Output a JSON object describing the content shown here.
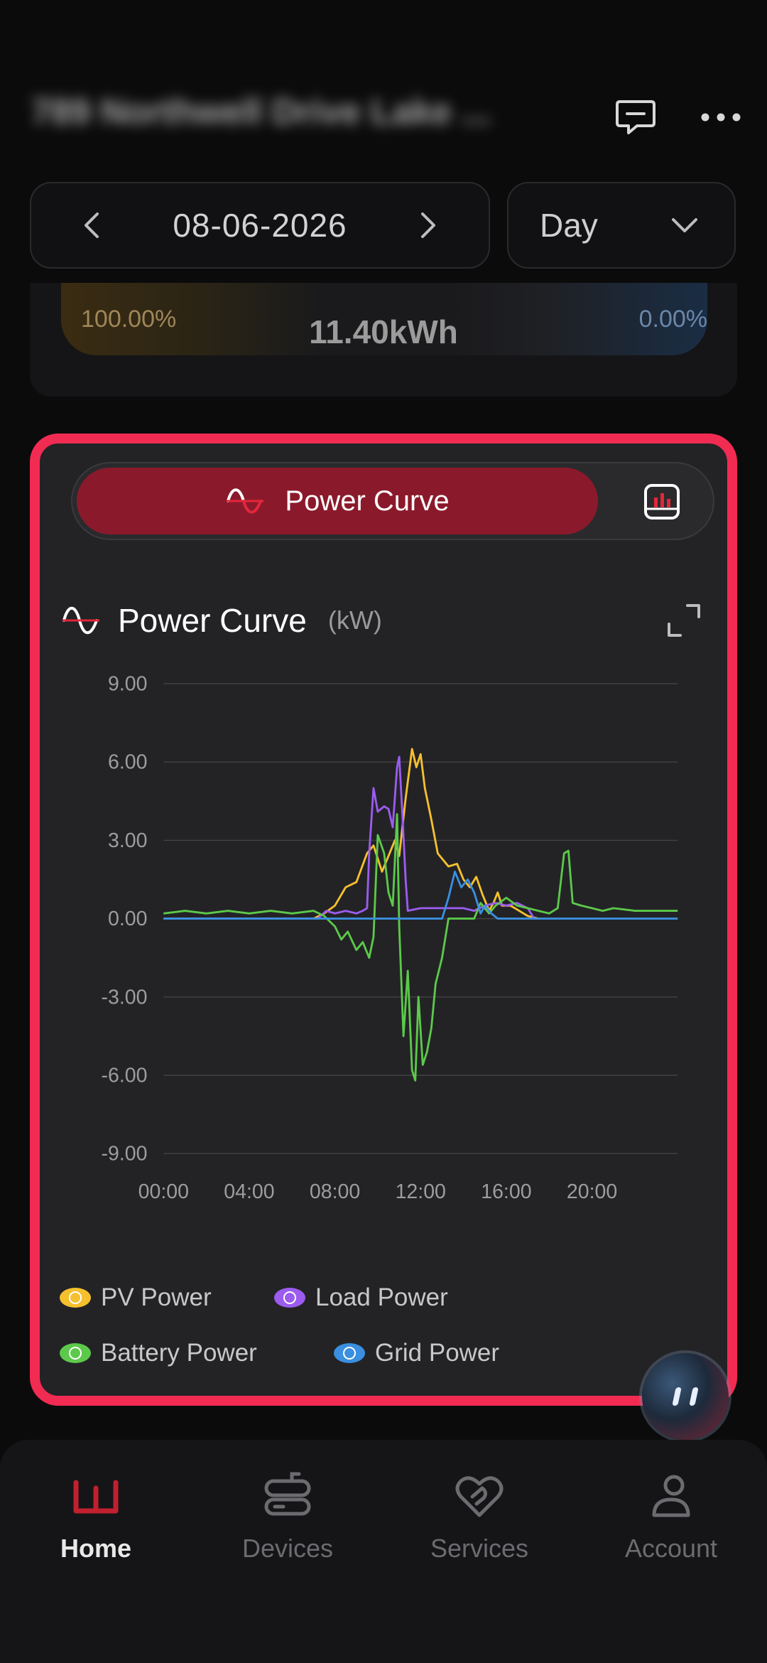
{
  "header": {
    "site_name": "789 Northwell Drive Lake ...",
    "message_icon": "message-icon",
    "more_icon": "more-icon"
  },
  "date_selector": {
    "date": "08-06-2026",
    "period": "Day"
  },
  "energy_summary": {
    "left_percent": "100.00%",
    "total": "11.40kWh",
    "right_percent": "0.00%"
  },
  "power_card": {
    "toggle_label": "Power Curve",
    "title": "Power Curve",
    "unit": "(kW)"
  },
  "chart_data": {
    "type": "line",
    "title": "Power Curve",
    "ylabel": "(kW)",
    "ylim": [
      -9,
      9
    ],
    "yticks": [
      "9.00",
      "6.00",
      "3.00",
      "0.00",
      "-3.00",
      "-6.00",
      "-9.00"
    ],
    "xticks": [
      "00:00",
      "04:00",
      "08:00",
      "12:00",
      "16:00",
      "20:00"
    ],
    "xlim": [
      0,
      24
    ],
    "grid": true,
    "legend_position": "bottom",
    "series": [
      {
        "name": "PV Power",
        "color": "#f5c02e",
        "points": [
          [
            0,
            0
          ],
          [
            7,
            0
          ],
          [
            7.5,
            0.2
          ],
          [
            8,
            0.5
          ],
          [
            8.5,
            1.2
          ],
          [
            9,
            1.4
          ],
          [
            9.5,
            2.5
          ],
          [
            9.8,
            2.8
          ],
          [
            10.2,
            1.8
          ],
          [
            10.5,
            2.4
          ],
          [
            10.8,
            3.0
          ],
          [
            11,
            2.4
          ],
          [
            11.3,
            4.6
          ],
          [
            11.6,
            6.5
          ],
          [
            11.8,
            5.8
          ],
          [
            12,
            6.3
          ],
          [
            12.2,
            5.0
          ],
          [
            12.5,
            3.8
          ],
          [
            12.8,
            2.5
          ],
          [
            13.3,
            2.0
          ],
          [
            13.7,
            2.1
          ],
          [
            14,
            1.5
          ],
          [
            14.3,
            1.2
          ],
          [
            14.6,
            1.6
          ],
          [
            14.9,
            0.9
          ],
          [
            15.2,
            0.3
          ],
          [
            15.4,
            0.6
          ],
          [
            15.6,
            1.0
          ],
          [
            15.8,
            0.5
          ],
          [
            16.2,
            0.5
          ],
          [
            16.6,
            0.3
          ],
          [
            17,
            0.1
          ],
          [
            17.5,
            0
          ]
        ]
      },
      {
        "name": "Load Power",
        "color": "#9c5cf0",
        "points": [
          [
            0,
            0
          ],
          [
            7.2,
            0
          ],
          [
            7.6,
            0.3
          ],
          [
            8,
            0.2
          ],
          [
            8.5,
            0.3
          ],
          [
            9,
            0.2
          ],
          [
            9.3,
            0.3
          ],
          [
            9.5,
            0.4
          ],
          [
            9.6,
            2.5
          ],
          [
            9.8,
            5.0
          ],
          [
            10,
            4.1
          ],
          [
            10.3,
            4.3
          ],
          [
            10.5,
            4.2
          ],
          [
            10.7,
            3.5
          ],
          [
            10.9,
            5.8
          ],
          [
            11,
            6.2
          ],
          [
            11.15,
            4.0
          ],
          [
            11.3,
            1.5
          ],
          [
            11.4,
            0.3
          ],
          [
            12,
            0.4
          ],
          [
            13,
            0.4
          ],
          [
            14,
            0.4
          ],
          [
            14.5,
            0.3
          ],
          [
            15,
            0.5
          ],
          [
            15.5,
            0.6
          ],
          [
            16,
            0.5
          ],
          [
            16.5,
            0.6
          ],
          [
            17,
            0.4
          ],
          [
            17.3,
            0
          ]
        ]
      },
      {
        "name": "Battery Power",
        "color": "#5cc94a",
        "points": [
          [
            0,
            0.2
          ],
          [
            1,
            0.3
          ],
          [
            2,
            0.2
          ],
          [
            3,
            0.3
          ],
          [
            4,
            0.2
          ],
          [
            5,
            0.3
          ],
          [
            6,
            0.2
          ],
          [
            7,
            0.3
          ],
          [
            7.5,
            0.1
          ],
          [
            8,
            -0.3
          ],
          [
            8.3,
            -0.8
          ],
          [
            8.6,
            -0.5
          ],
          [
            9,
            -1.2
          ],
          [
            9.3,
            -0.9
          ],
          [
            9.6,
            -1.5
          ],
          [
            9.8,
            -0.7
          ],
          [
            10,
            3.2
          ],
          [
            10.3,
            2.5
          ],
          [
            10.5,
            1.0
          ],
          [
            10.7,
            0.5
          ],
          [
            10.9,
            4.0
          ],
          [
            11,
            -0.3
          ],
          [
            11.2,
            -4.5
          ],
          [
            11.4,
            -2.0
          ],
          [
            11.6,
            -5.8
          ],
          [
            11.75,
            -6.2
          ],
          [
            11.9,
            -3.0
          ],
          [
            12.1,
            -5.6
          ],
          [
            12.3,
            -5.1
          ],
          [
            12.5,
            -4.2
          ],
          [
            12.7,
            -2.5
          ],
          [
            13,
            -1.5
          ],
          [
            13.3,
            0.0
          ],
          [
            14,
            0.0
          ],
          [
            14.5,
            0.0
          ],
          [
            14.8,
            0.6
          ],
          [
            15.2,
            0.2
          ],
          [
            15.5,
            0.5
          ],
          [
            16,
            0.8
          ],
          [
            16.5,
            0.5
          ],
          [
            17,
            0.4
          ],
          [
            17.5,
            0.3
          ],
          [
            18,
            0.2
          ],
          [
            18.4,
            0.4
          ],
          [
            18.7,
            2.5
          ],
          [
            18.9,
            2.6
          ],
          [
            19.1,
            0.6
          ],
          [
            19.5,
            0.5
          ],
          [
            20,
            0.4
          ],
          [
            20.5,
            0.3
          ],
          [
            21,
            0.4
          ],
          [
            22,
            0.3
          ],
          [
            23,
            0.3
          ],
          [
            24,
            0.3
          ]
        ]
      },
      {
        "name": "Grid Power",
        "color": "#3a8fe0",
        "points": [
          [
            0,
            0
          ],
          [
            13,
            0
          ],
          [
            13.3,
            0.8
          ],
          [
            13.6,
            1.8
          ],
          [
            13.9,
            1.2
          ],
          [
            14.2,
            1.5
          ],
          [
            14.5,
            1.0
          ],
          [
            14.8,
            0.2
          ],
          [
            15,
            0.5
          ],
          [
            15.3,
            0.2
          ],
          [
            15.6,
            0.0
          ],
          [
            24,
            0
          ]
        ]
      }
    ]
  },
  "nav": {
    "home": "Home",
    "devices": "Devices",
    "services": "Services",
    "account": "Account"
  }
}
